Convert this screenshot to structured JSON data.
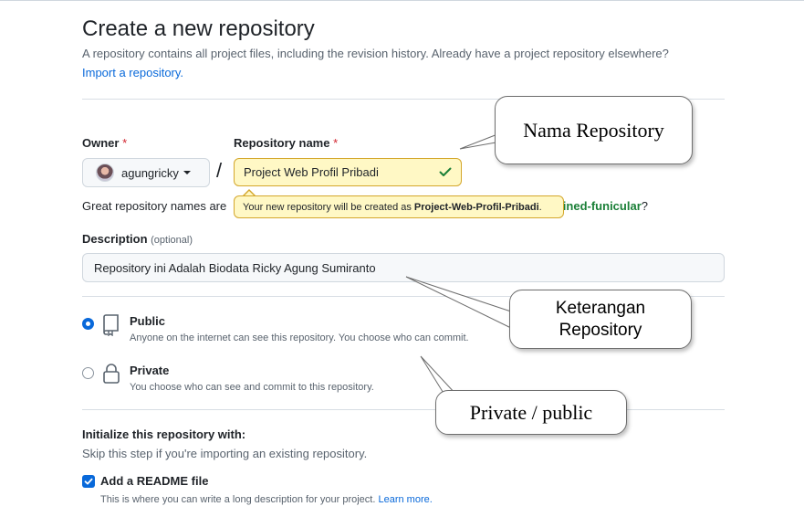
{
  "header": {
    "title": "Create a new repository",
    "subtitle": "A repository contains all project files, including the revision history. Already have a project repository elsewhere?",
    "import_link": "Import a repository."
  },
  "owner": {
    "label": "Owner",
    "required_mark": "*",
    "selected": "agungricky"
  },
  "repo_name": {
    "label": "Repository name",
    "required_mark": "*",
    "value": "Project Web Profil Pribadi",
    "separator": "/"
  },
  "name_hint": {
    "prefix": "Great repository names are",
    "suggestion_visible": "gined-funicular",
    "suffix": "?"
  },
  "tooltip": {
    "prefix": "Your new repository will be created as ",
    "name": "Project-Web-Profil-Pribadi",
    "suffix": "."
  },
  "description": {
    "label": "Description",
    "optional": "(optional)",
    "value": "Repository ini Adalah Biodata Ricky Agung Sumiranto"
  },
  "visibility": [
    {
      "title": "Public",
      "desc": "Anyone on the internet can see this repository. You choose who can commit.",
      "selected": true,
      "icon": "repo-icon"
    },
    {
      "title": "Private",
      "desc": "You choose who can see and commit to this repository.",
      "selected": false,
      "icon": "lock-icon"
    }
  ],
  "initialize": {
    "title": "Initialize this repository with:",
    "desc": "Skip this step if you're importing an existing repository.",
    "readme_label": "Add a README file",
    "readme_checked": true,
    "readme_desc": "This is where you can write a long description for your project.",
    "readme_link": "Learn more."
  },
  "annotations": {
    "repo_name": "Nama Repository",
    "description": [
      "Keterangan",
      "Repository"
    ],
    "visibility": "Private / public"
  },
  "colors": {
    "link": "#0969da",
    "success": "#1a7f37",
    "required": "#d1242f",
    "highlight": "#fff8c5"
  }
}
